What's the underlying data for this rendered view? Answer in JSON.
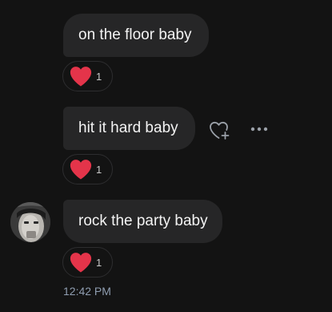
{
  "messages": [
    {
      "text": "on the floor baby",
      "reaction": {
        "icon": "heart-icon",
        "count": "1"
      }
    },
    {
      "text": "hit it hard baby",
      "reaction": {
        "icon": "heart-icon",
        "count": "1"
      }
    },
    {
      "text": "rock the party baby",
      "reaction": {
        "icon": "heart-icon",
        "count": "1"
      }
    }
  ],
  "actions": {
    "react_icon": "heart-plus-icon",
    "more_icon": "more-horizontal-icon"
  },
  "sender": {
    "avatar_icon": "avatar"
  },
  "timestamp": "12:42 PM",
  "colors": {
    "background": "#131313",
    "bubble": "#262627",
    "heart": "#e4344a",
    "timestamp": "#8f9db0"
  }
}
